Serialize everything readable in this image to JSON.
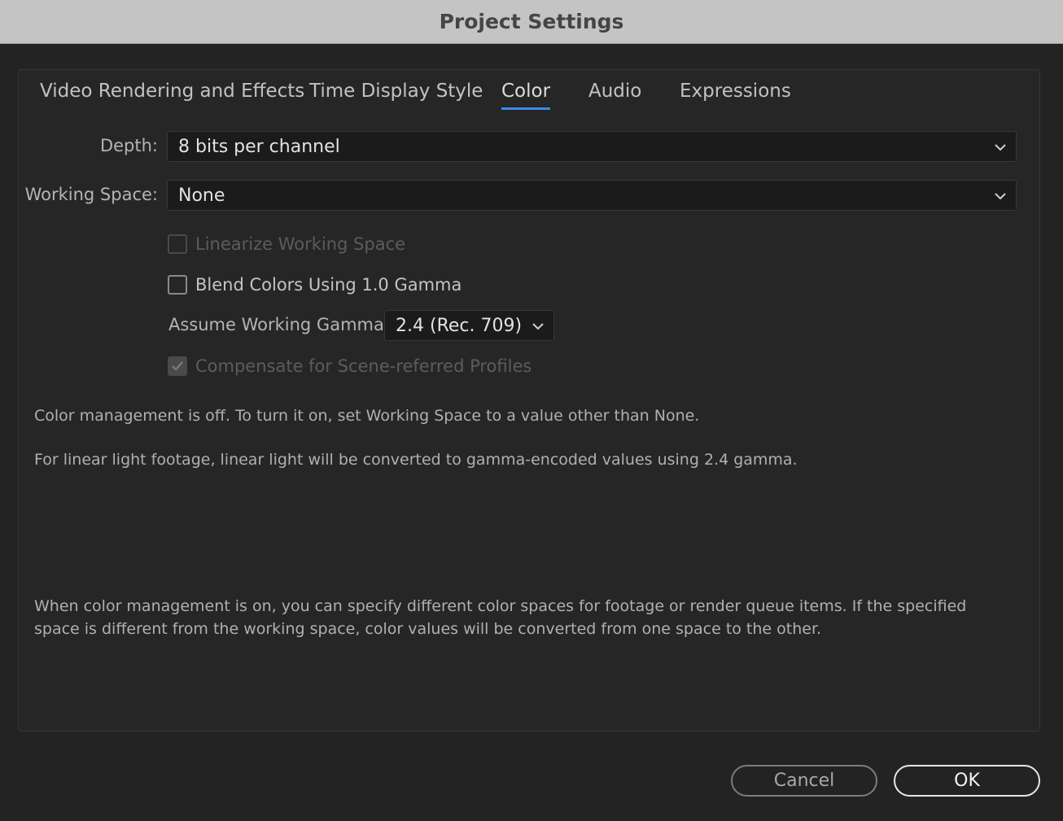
{
  "window": {
    "title": "Project Settings"
  },
  "tabs": [
    {
      "label": "Video Rendering and Effects",
      "active": false
    },
    {
      "label": "Time Display Style",
      "active": false
    },
    {
      "label": "Color",
      "active": true
    },
    {
      "label": "Audio",
      "active": false
    },
    {
      "label": "Expressions",
      "active": false
    }
  ],
  "color": {
    "depth_label": "Depth:",
    "depth_value": "8 bits per channel",
    "working_space_label": "Working Space:",
    "working_space_value": "None",
    "linearize": {
      "label": "Linearize Working Space",
      "checked": false,
      "enabled": false
    },
    "blend_gamma": {
      "label": "Blend Colors Using 1.0 Gamma",
      "checked": false,
      "enabled": true
    },
    "assume_gamma_label": "Assume Working Gamma:",
    "assume_gamma_value": "2.4 (Rec. 709)",
    "compensate": {
      "label": "Compensate for Scene-referred Profiles",
      "checked": true,
      "enabled": false
    },
    "info_off": "Color management is off. To turn it on, set Working Space to a value other than None.",
    "info_linear": "For linear light footage, linear light will be converted to gamma-encoded values using 2.4 gamma.",
    "info_on": "When color management is on, you can specify different color spaces for footage or render queue items. If the specified space is different from the working space, color values will be converted from one space to the other."
  },
  "buttons": {
    "cancel_label": "Cancel",
    "ok_label": "OK"
  },
  "colors": {
    "accent": "#3d8ae8",
    "background": "#232323",
    "titlebar": "#c4c4c4"
  }
}
